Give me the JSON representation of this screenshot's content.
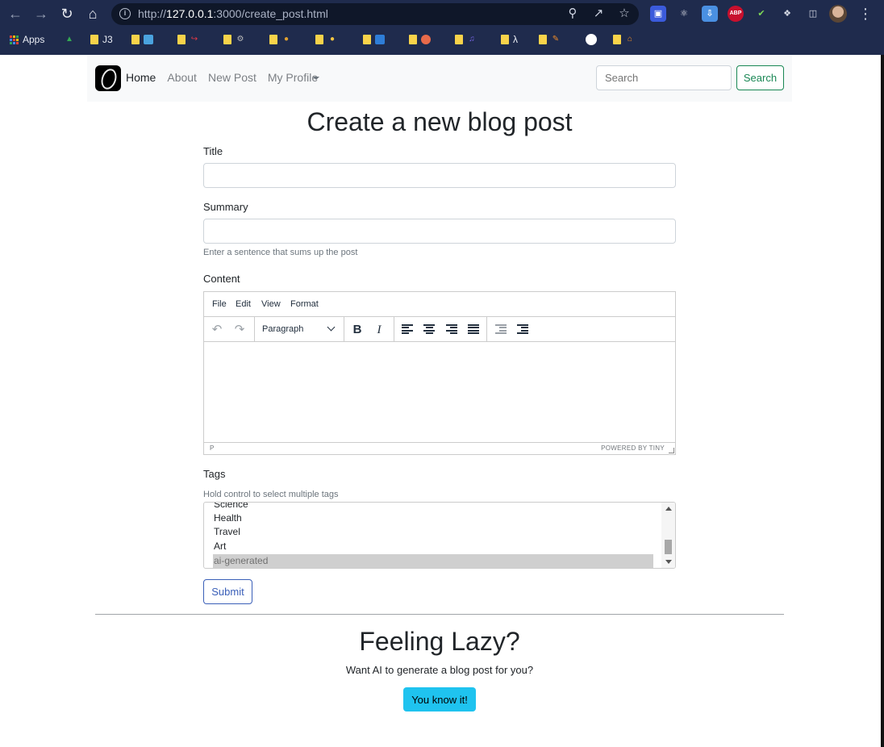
{
  "browser": {
    "url_prefix": "http://",
    "url_host": "127.0.0.1",
    "url_rest": ":3000/create_post.html",
    "bookmarks": [
      "Apps",
      "J3",
      "λ"
    ]
  },
  "navbar": {
    "links": [
      "Home",
      "About",
      "New Post",
      "My Profile"
    ],
    "search_placeholder": "Search",
    "search_button": "Search"
  },
  "form": {
    "heading": "Create a new blog post",
    "title_label": "Title",
    "summary_label": "Summary",
    "summary_help": "Enter a sentence that sums up the post",
    "content_label": "Content",
    "editor": {
      "menu": [
        "File",
        "Edit",
        "View",
        "Format"
      ],
      "block_format": "Paragraph",
      "status_path": "P",
      "powered_by": "POWERED BY TINY"
    },
    "tags_label": "Tags",
    "tags_help": "Hold control to select multiple tags",
    "tags": [
      "Science",
      "Health",
      "Travel",
      "Art",
      "ai-generated"
    ],
    "tags_selected": "ai-generated",
    "submit_label": "Submit"
  },
  "lazy": {
    "heading": "Feeling Lazy?",
    "subtitle": "Want AI to generate a blog post for you?",
    "button": "You know it!"
  },
  "colors": {
    "chrome_bg": "#1f2b4d",
    "search_btn": "#198754",
    "submit_btn": "#3a5fb8",
    "lazy_btn": "#1fc3ef"
  }
}
